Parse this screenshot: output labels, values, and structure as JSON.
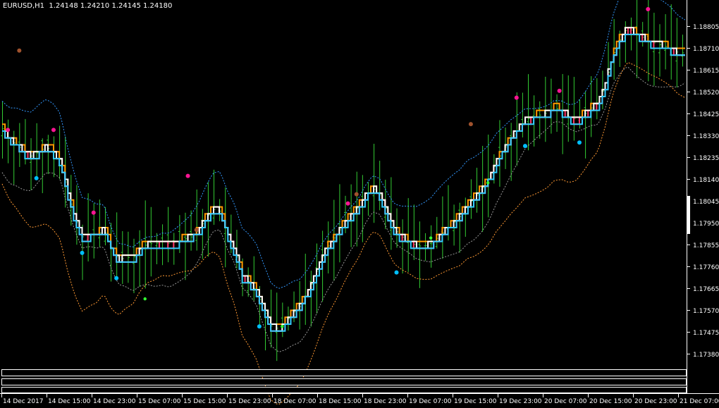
{
  "window": {
    "symbol": "EURUSD,H1",
    "ohlc": [
      "1.24148",
      "1.24210",
      "1.24145",
      "1.24180"
    ]
  },
  "colors": {
    "background": "#000000",
    "candles": "#33cc33",
    "mid_line": "#ffffff",
    "fast_line": "#33ccff",
    "bear_line": "#ff3366",
    "bull_line": "#ff9900",
    "upper_band": "#3399ff",
    "lower_band": "#ff9933",
    "inner_band": "#999999",
    "dot_pink": "#ff1493",
    "dot_blue": "#00bfff",
    "dot_green": "#33ff33",
    "dot_brown": "#a0522d"
  },
  "chart_data": {
    "type": "line",
    "title": "EURUSD,H1",
    "ylim": [
      1.1732,
      1.1892
    ],
    "y_ticks": [
      "1.18805",
      "1.18710",
      "1.18615",
      "1.18520",
      "1.18425",
      "1.18330",
      "1.18235",
      "1.18140",
      "1.18045",
      "1.17950",
      "1.17855",
      "1.17760",
      "1.17665",
      "1.17570",
      "1.17475",
      "1.17380"
    ],
    "x_ticks": [
      "14 Dec 2017",
      "14 Dec 15:00",
      "14 Dec 23:00",
      "15 Dec 07:00",
      "15 Dec 15:00",
      "15 Dec 23:00",
      "18 Dec 07:00",
      "18 Dec 15:00",
      "18 Dec 23:00",
      "19 Dec 07:00",
      "19 Dec 15:00",
      "19 Dec 23:00",
      "20 Dec 07:00",
      "20 Dec 15:00",
      "20 Dec 23:00",
      "21 Dec 07:00"
    ],
    "bars": 120,
    "series": [
      {
        "values": [
          1.1836,
          1.1831,
          1.1829,
          1.1826,
          1.1824,
          1.1826,
          1.1828,
          1.1826,
          1.1822,
          1.1808,
          1.1797,
          1.1789,
          1.179,
          1.179,
          1.1792,
          1.1784,
          1.1779,
          1.178,
          1.178,
          1.1784,
          1.1786,
          1.1786,
          1.1787,
          1.1786,
          1.1787,
          1.1788,
          1.1789,
          1.1792,
          1.1797,
          1.1801,
          1.18,
          1.179,
          1.1783,
          1.1772,
          1.1769,
          1.1765,
          1.1757,
          1.175,
          1.1749,
          1.1752,
          1.1756,
          1.1759,
          1.1765,
          1.1772,
          1.178,
          1.1786,
          1.179,
          1.1795,
          1.1799,
          1.1802,
          1.1807,
          1.181,
          1.1807,
          1.1799,
          1.1792,
          1.1789,
          1.1787,
          1.1785,
          1.1785,
          1.1786,
          1.1789,
          1.1792,
          1.1795,
          1.1798,
          1.1803,
          1.1806,
          1.181,
          1.1815,
          1.1822,
          1.1827,
          1.1832,
          1.1836,
          1.184,
          1.1841,
          1.1842,
          1.1843,
          1.1845,
          1.1844,
          1.1841,
          1.184,
          1.1842,
          1.1845,
          1.1847,
          1.1856,
          1.1868,
          1.1875,
          1.188,
          1.1878,
          1.1876,
          1.1874,
          1.1873,
          1.1872,
          1.1871,
          1.1869,
          1.1869
        ]
      }
    ],
    "markers": {
      "pink": [
        [
          2,
          1.18355
        ],
        [
          18,
          1.18355
        ],
        [
          32,
          1.17995
        ],
        [
          65,
          1.18155
        ],
        [
          121,
          1.18035
        ],
        [
          180,
          1.18495
        ],
        [
          195,
          1.18525
        ],
        [
          226,
          1.1888
        ]
      ],
      "blue": [
        [
          12,
          1.18145
        ],
        [
          28,
          1.1782
        ],
        [
          40,
          1.1771
        ],
        [
          90,
          1.175
        ],
        [
          138,
          1.17735
        ],
        [
          183,
          1.18285
        ],
        [
          202,
          1.183
        ]
      ],
      "green": [
        [
          50,
          1.1762
        ],
        [
          98,
          1.175
        ],
        [
          150,
          1.17885
        ],
        [
          170,
          1.18125
        ]
      ],
      "brown": [
        [
          6,
          1.187
        ],
        [
          68,
          1.1792
        ],
        [
          124,
          1.18075
        ],
        [
          164,
          1.1838
        ]
      ]
    }
  }
}
